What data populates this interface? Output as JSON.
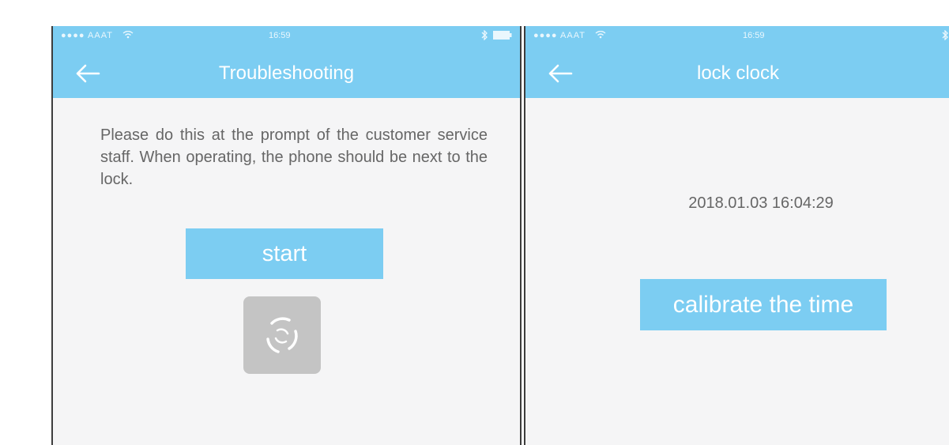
{
  "left_screen": {
    "status": {
      "carrier": "AAAT",
      "time": "16:59"
    },
    "nav": {
      "title": "Troubleshooting"
    },
    "instruction": "Please do this at the prompt of the customer service staff. When operating, the phone should be next to the lock.",
    "start_label": "start"
  },
  "right_screen": {
    "status": {
      "carrier": "AAAT",
      "time": "16:59"
    },
    "nav": {
      "title": "lock clock"
    },
    "datetime": "2018.01.03 16:04:29",
    "calibrate_label": "calibrate the time"
  },
  "colors": {
    "accent": "#7ccdf2",
    "background": "#f5f5f6",
    "spinner_bg": "#c4c4c4",
    "text": "#666666"
  },
  "icons": {
    "back": "arrow-left-icon",
    "spinner": "loading-spinner-icon",
    "wifi": "wifi-icon",
    "bluetooth": "bluetooth-icon",
    "battery": "battery-icon"
  }
}
